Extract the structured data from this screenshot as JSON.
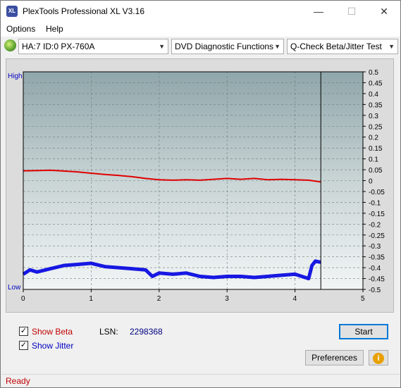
{
  "window": {
    "title": "PlexTools Professional XL V3.16",
    "icon_label": "XL",
    "controls": {
      "minimize": "—",
      "maximize": "☐",
      "close": "✕"
    }
  },
  "menu": {
    "options": "Options",
    "help": "Help"
  },
  "toolbar": {
    "drive": "HA:7 ID:0  PX-760A",
    "function": "DVD Diagnostic Functions",
    "test": "Q-Check Beta/Jitter Test"
  },
  "chart_data": {
    "type": "line",
    "x_ticks": [
      "0",
      "1",
      "2",
      "3",
      "4",
      "5"
    ],
    "y_right_ticks": [
      "0.5",
      "0.45",
      "0.4",
      "0.35",
      "0.3",
      "0.25",
      "0.2",
      "0.15",
      "0.1",
      "0.05",
      "0",
      "-0.05",
      "-0.1",
      "-0.15",
      "-0.2",
      "-0.25",
      "-0.3",
      "-0.35",
      "-0.4",
      "-0.45",
      "-0.5"
    ],
    "y_left_labels": {
      "high": "High",
      "low": "Low"
    },
    "xlim": [
      0,
      5
    ],
    "ylim": [
      -0.5,
      0.5
    ],
    "end_marker_x": 4.38,
    "series": [
      {
        "color": "#e00000",
        "x": [
          0,
          0.2,
          0.4,
          0.6,
          0.8,
          1.0,
          1.2,
          1.4,
          1.6,
          1.8,
          2.0,
          2.2,
          2.4,
          2.6,
          2.8,
          3.0,
          3.2,
          3.4,
          3.6,
          3.8,
          4.0,
          4.2,
          4.38
        ],
        "values": [
          0.045,
          0.046,
          0.048,
          0.044,
          0.04,
          0.034,
          0.028,
          0.024,
          0.018,
          0.01,
          0.004,
          0.002,
          0.004,
          0.002,
          0.006,
          0.01,
          0.006,
          0.01,
          0.004,
          0.006,
          0.004,
          0.002,
          -0.006
        ]
      },
      {
        "color": "#0000e0",
        "x": [
          0,
          0.1,
          0.2,
          0.4,
          0.6,
          0.8,
          1.0,
          1.2,
          1.4,
          1.6,
          1.8,
          1.9,
          2.0,
          2.2,
          2.4,
          2.6,
          2.8,
          3.0,
          3.2,
          3.4,
          3.6,
          3.8,
          4.0,
          4.2,
          4.25,
          4.3,
          4.38
        ],
        "values": [
          -0.43,
          -0.41,
          -0.42,
          -0.405,
          -0.39,
          -0.385,
          -0.38,
          -0.395,
          -0.4,
          -0.405,
          -0.41,
          -0.44,
          -0.425,
          -0.43,
          -0.425,
          -0.44,
          -0.445,
          -0.44,
          -0.44,
          -0.445,
          -0.44,
          -0.435,
          -0.43,
          -0.45,
          -0.39,
          -0.37,
          -0.375
        ]
      }
    ]
  },
  "options": {
    "show_beta": {
      "label": "Show Beta",
      "checked": true,
      "color": "#c00000"
    },
    "show_jitter": {
      "label": "Show Jitter",
      "checked": true,
      "color": "#0000c0"
    },
    "lsn_label": "LSN:",
    "lsn_value": "2298368"
  },
  "buttons": {
    "start": "Start",
    "preferences": "Preferences",
    "info_icon": "info-icon"
  },
  "status": {
    "text": "Ready"
  }
}
